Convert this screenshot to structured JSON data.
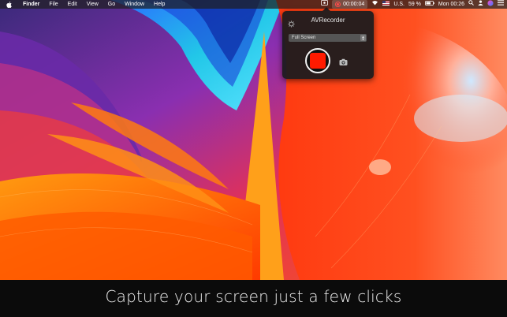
{
  "menubar": {
    "app_name": "Finder",
    "items": [
      "File",
      "Edit",
      "View",
      "Go",
      "Window",
      "Help"
    ],
    "recording_time": "00:00:04",
    "input_source": "U.S.",
    "battery": "59 %",
    "clock": "Mon 00:26"
  },
  "popover": {
    "title": "AVRecorder",
    "capture_mode": "Full Screen"
  },
  "caption": "Capture your screen just a few clicks",
  "colors": {
    "record_red": "#ff1a00",
    "menubar_bg": "#1e1e1e",
    "popover_bg": "#1c1c1e"
  },
  "icons": [
    "apple-icon",
    "record-status-icon",
    "wifi-icon",
    "flag-icon",
    "battery-icon",
    "search-icon",
    "user-icon",
    "siri-icon",
    "notification-center-icon",
    "gear-icon",
    "camera-icon"
  ]
}
